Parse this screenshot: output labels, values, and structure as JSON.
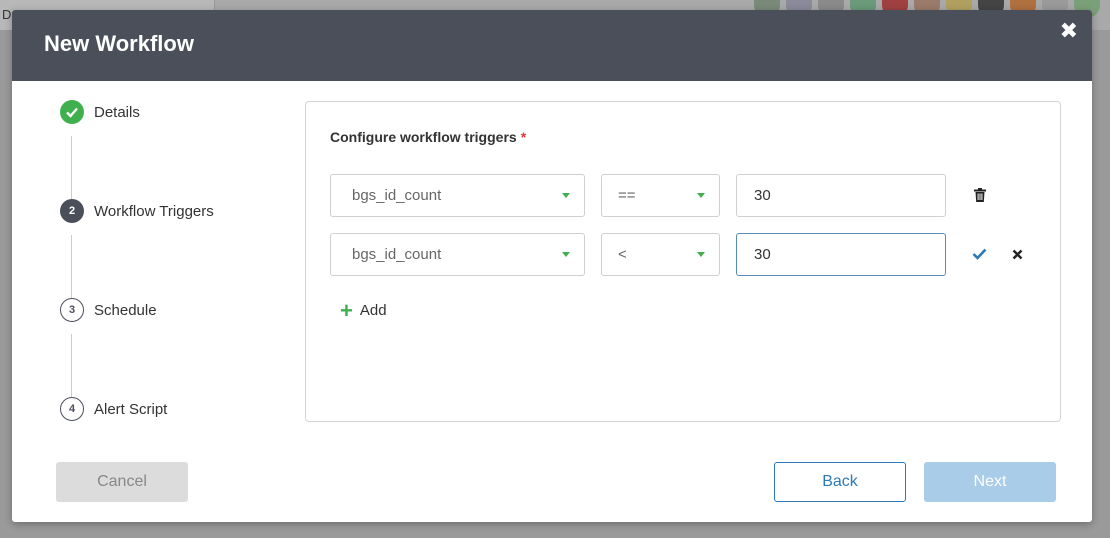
{
  "background": {
    "tab_text": "D"
  },
  "modal": {
    "title": "New Workflow",
    "close_glyph": "✖"
  },
  "steps": [
    {
      "marker": "",
      "label": "Details",
      "state": "done"
    },
    {
      "marker": "2",
      "label": "Workflow Triggers",
      "state": "active"
    },
    {
      "marker": "3",
      "label": "Schedule",
      "state": "todo"
    },
    {
      "marker": "4",
      "label": "Alert Script",
      "state": "todo"
    }
  ],
  "panel": {
    "title": "Configure workflow triggers",
    "required_mark": "*",
    "triggers": [
      {
        "field": "bgs_id_count",
        "operator": "==",
        "value": "30",
        "actions": [
          "trash-icon"
        ]
      },
      {
        "field": "bgs_id_count",
        "operator": "<",
        "value": "30",
        "actions": [
          "checkmark-icon",
          "close-icon"
        ]
      }
    ],
    "add_label": "Add",
    "add_glyph": "+"
  },
  "footer": {
    "cancel_label": "Cancel",
    "back_label": "Back",
    "next_label": "Next"
  },
  "colors": {
    "header": "#4a4f5a",
    "success": "#3fb04d",
    "primary": "#2e7ab8",
    "next_disabled": "#a9cce8",
    "required": "#e53935"
  }
}
